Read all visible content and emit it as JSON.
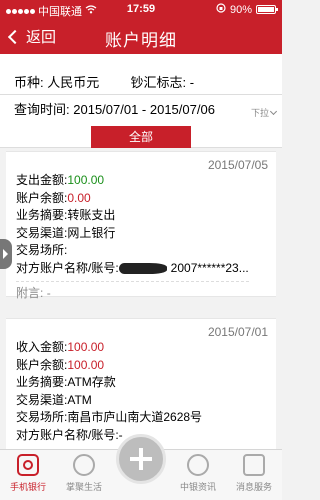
{
  "status_bar": {
    "carrier": "中国联通",
    "time": "17:59",
    "battery": "90%"
  },
  "nav": {
    "back_label": "返回",
    "title": "账户明细"
  },
  "filter": {
    "currency_label": "币种:",
    "currency_value": "人民币元",
    "cash_flag_label": "钞汇标志:",
    "cash_flag_value": "-",
    "query_time_label": "查询时间:",
    "date_range": "2015/07/01 - 2015/07/06",
    "pull_label": "下拉",
    "all_button": "全部"
  },
  "transactions": [
    {
      "date": "2015/07/05",
      "amount_label": "支出金额:",
      "amount": "100.00",
      "balance_label": "账户余额:",
      "balance": "0.00",
      "summary_label": "业务摘要:",
      "summary": "转账支出",
      "channel_label": "交易渠道:",
      "channel": "网上银行",
      "place_label": "交易场所:",
      "place": "",
      "counterparty_label": "对方账户名称/账号:",
      "counterparty": "2007******23...",
      "note_label": "附言:",
      "note": "-"
    },
    {
      "date": "2015/07/01",
      "amount_label": "收入金额:",
      "amount": "100.00",
      "balance_label": "账户余额:",
      "balance": "100.00",
      "summary_label": "业务摘要:",
      "summary": "ATM存款",
      "channel_label": "交易渠道:",
      "channel": "ATM",
      "place_label": "交易场所:",
      "place": "南昌市庐山南大道2628号",
      "counterparty_label": "对方账户名称/账号:",
      "counterparty": "-"
    }
  ],
  "tabbar": [
    {
      "label": "手机银行",
      "icon": "mobile-bank-icon"
    },
    {
      "label": "掌聚生活",
      "icon": "life-icon"
    },
    {
      "label": "",
      "icon": "plus-icon"
    },
    {
      "label": "中银资讯",
      "icon": "news-icon"
    },
    {
      "label": "消息服务",
      "icon": "message-icon"
    }
  ],
  "colors": {
    "brand_red": "#c8202a",
    "expense_green": "#1a8f1a"
  }
}
